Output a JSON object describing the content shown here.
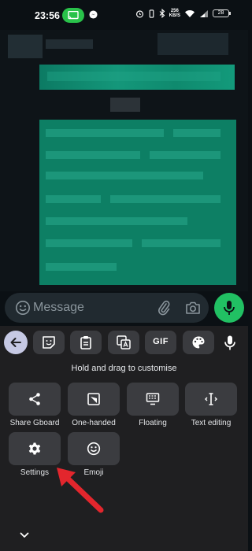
{
  "status_bar": {
    "time": "23:56",
    "net_speed_top": "256",
    "net_speed_bottom": "KB/S",
    "battery": "28"
  },
  "composer": {
    "placeholder": "Message"
  },
  "keyboard": {
    "toolbar": {
      "gif_label": "GIF"
    },
    "hint": "Hold and drag to customise",
    "tiles": [
      {
        "label": "Share Gboard",
        "icon": "share-icon"
      },
      {
        "label": "One-handed",
        "icon": "one-handed-icon"
      },
      {
        "label": "Floating",
        "icon": "floating-keyboard-icon"
      },
      {
        "label": "Text editing",
        "icon": "text-cursor-icon"
      },
      {
        "label": "Settings",
        "icon": "gear-icon"
      },
      {
        "label": "Emoji",
        "icon": "smiley-icon"
      }
    ]
  },
  "colors": {
    "accent_green": "#21c063",
    "annotation_arrow": "#e3262d"
  }
}
